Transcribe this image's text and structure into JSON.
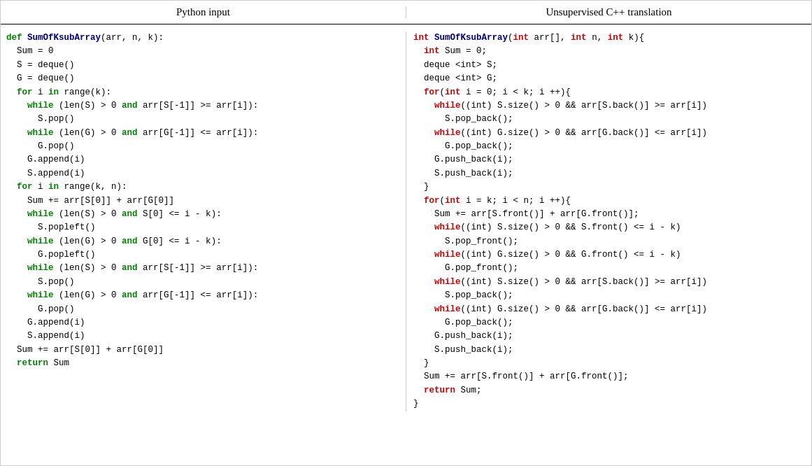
{
  "header": {
    "left": "Python input",
    "right": "Unsupervised C++ translation"
  },
  "python": {
    "lines": [
      {
        "indent": 0,
        "text": "def SumOfKsubArray(arr, n, k):"
      },
      {
        "indent": 1,
        "text": "Sum = 0"
      },
      {
        "indent": 1,
        "text": "S = deque()"
      },
      {
        "indent": 1,
        "text": "G = deque()"
      },
      {
        "indent": 1,
        "text": "for i in range(k):"
      },
      {
        "indent": 2,
        "text": "while (len(S) > 0 and arr[S[-1]] >= arr[i]):"
      },
      {
        "indent": 3,
        "text": "S.pop()"
      },
      {
        "indent": 2,
        "text": "while (len(G) > 0 and arr[G[-1]] <= arr[i]):"
      },
      {
        "indent": 3,
        "text": "G.pop()"
      },
      {
        "indent": 2,
        "text": "G.append(i)"
      },
      {
        "indent": 2,
        "text": "S.append(i)"
      },
      {
        "indent": 1,
        "text": "for i in range(k, n):"
      },
      {
        "indent": 2,
        "text": "Sum += arr[S[0]] + arr[G[0]]"
      },
      {
        "indent": 2,
        "text": "while (len(S) > 0 and S[0] <= i - k):"
      },
      {
        "indent": 3,
        "text": "S.popleft()"
      },
      {
        "indent": 2,
        "text": "while (len(G) > 0 and G[0] <= i - k):"
      },
      {
        "indent": 3,
        "text": "G.popleft()"
      },
      {
        "indent": 2,
        "text": "while (len(S) > 0 and arr[S[-1]] >= arr[i]):"
      },
      {
        "indent": 3,
        "text": "S.pop()"
      },
      {
        "indent": 2,
        "text": "while (len(G) > 0 and arr[G[-1]] <= arr[i]):"
      },
      {
        "indent": 3,
        "text": "G.pop()"
      },
      {
        "indent": 2,
        "text": "G.append(i)"
      },
      {
        "indent": 2,
        "text": "S.append(i)"
      },
      {
        "indent": 1,
        "text": "Sum += arr[S[0]] + arr[G[0]]"
      },
      {
        "indent": 1,
        "text": "return Sum"
      }
    ]
  },
  "cpp": {
    "lines": [
      {
        "indent": 0,
        "text": "int SumOfKsubArray(int arr[], int n, int k){"
      },
      {
        "indent": 1,
        "text": "int Sum = 0;"
      },
      {
        "indent": 1,
        "text": "deque <int> S;"
      },
      {
        "indent": 1,
        "text": "deque <int> G;"
      },
      {
        "indent": 1,
        "text": "for(int i = 0; i < k; i ++){"
      },
      {
        "indent": 2,
        "text": "while((int) S.size() > 0 && arr[S.back()] >= arr[i])"
      },
      {
        "indent": 3,
        "text": "S.pop_back();"
      },
      {
        "indent": 2,
        "text": "while((int) G.size() > 0 && arr[G.back()] <= arr[i])"
      },
      {
        "indent": 3,
        "text": "G.pop_back();"
      },
      {
        "indent": 2,
        "text": "G.push_back(i);"
      },
      {
        "indent": 2,
        "text": "S.push_back(i);"
      },
      {
        "indent": 1,
        "text": "}"
      },
      {
        "indent": 1,
        "text": "for(int i = k; i < n; i ++){"
      },
      {
        "indent": 2,
        "text": "Sum += arr[S.front()] + arr[G.front()];"
      },
      {
        "indent": 2,
        "text": "while((int) S.size() > 0 && S.front() <= i - k)"
      },
      {
        "indent": 3,
        "text": "S.pop_front();"
      },
      {
        "indent": 2,
        "text": "while((int) G.size() > 0 && G.front() <= i - k)"
      },
      {
        "indent": 3,
        "text": "G.pop_front();"
      },
      {
        "indent": 2,
        "text": "while((int) S.size() > 0 && arr[S.back()] >= arr[i])"
      },
      {
        "indent": 3,
        "text": "S.pop_back();"
      },
      {
        "indent": 2,
        "text": "while((int) G.size() > 0 && arr[G.back()] <= arr[i])"
      },
      {
        "indent": 3,
        "text": "G.pop_back();"
      },
      {
        "indent": 2,
        "text": "G.push_back(i);"
      },
      {
        "indent": 2,
        "text": "S.push_back(i);"
      },
      {
        "indent": 1,
        "text": "}"
      },
      {
        "indent": 1,
        "text": "Sum += arr[S.front()] + arr[G.front()];"
      },
      {
        "indent": 1,
        "text": "return Sum;"
      },
      {
        "indent": 0,
        "text": "}"
      }
    ]
  }
}
